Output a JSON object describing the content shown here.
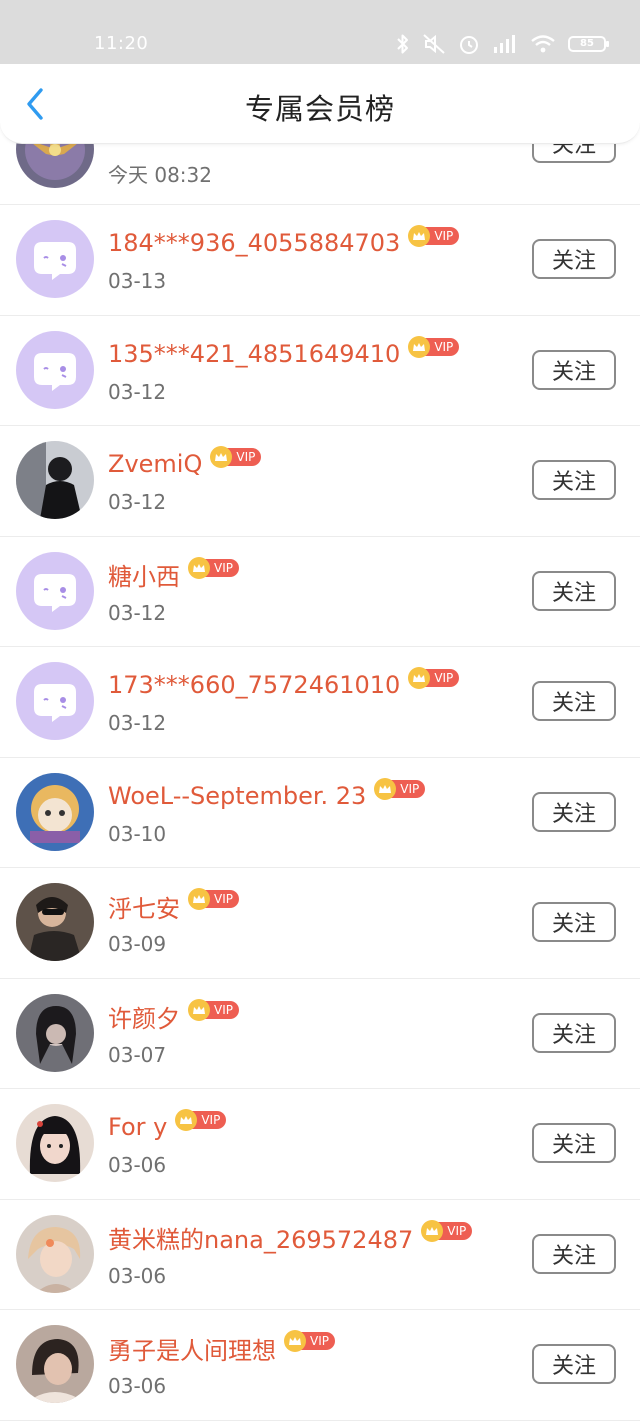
{
  "status_bar": {
    "time": "11:20",
    "battery": "85",
    "icons": [
      "bluetooth-icon",
      "mute-icon",
      "alarm-icon",
      "signal-icon",
      "wifi-icon",
      "battery-icon"
    ]
  },
  "header": {
    "title": "专属会员榜",
    "back_icon": "chevron-left-icon"
  },
  "colors": {
    "accent": "#2f9bf0",
    "name": "#e05a3a",
    "vip_badge": "#ee5e52",
    "crown": "#f7c343",
    "default_avatar": "#d5c7f5"
  },
  "vip_label": "VIP",
  "follow_label": "关注",
  "members": [
    {
      "name": "",
      "date": "今天 08:32",
      "avatar": "flower-photo"
    },
    {
      "name": "184***936_4055884703",
      "date": "03-13",
      "avatar": "default-avatar"
    },
    {
      "name": "135***421_4851649410",
      "date": "03-12",
      "avatar": "default-avatar"
    },
    {
      "name": "ZvemiQ",
      "date": "03-12",
      "avatar": "dark-photo"
    },
    {
      "name": "糖小西",
      "date": "03-12",
      "avatar": "default-avatar"
    },
    {
      "name": "173***660_7572461010",
      "date": "03-12",
      "avatar": "default-avatar"
    },
    {
      "name": "WoeL--September. 23",
      "date": "03-10",
      "avatar": "cartoon-photo"
    },
    {
      "name": "泘七安",
      "date": "03-09",
      "avatar": "person-photo"
    },
    {
      "name": "许颜夕",
      "date": "03-07",
      "avatar": "person-photo"
    },
    {
      "name": "For y",
      "date": "03-06",
      "avatar": "person-photo"
    },
    {
      "name": "黄米糕的nana_269572487",
      "date": "03-06",
      "avatar": "person-photo"
    },
    {
      "name": "勇子是人间理想",
      "date": "03-06",
      "avatar": "person-photo"
    }
  ]
}
